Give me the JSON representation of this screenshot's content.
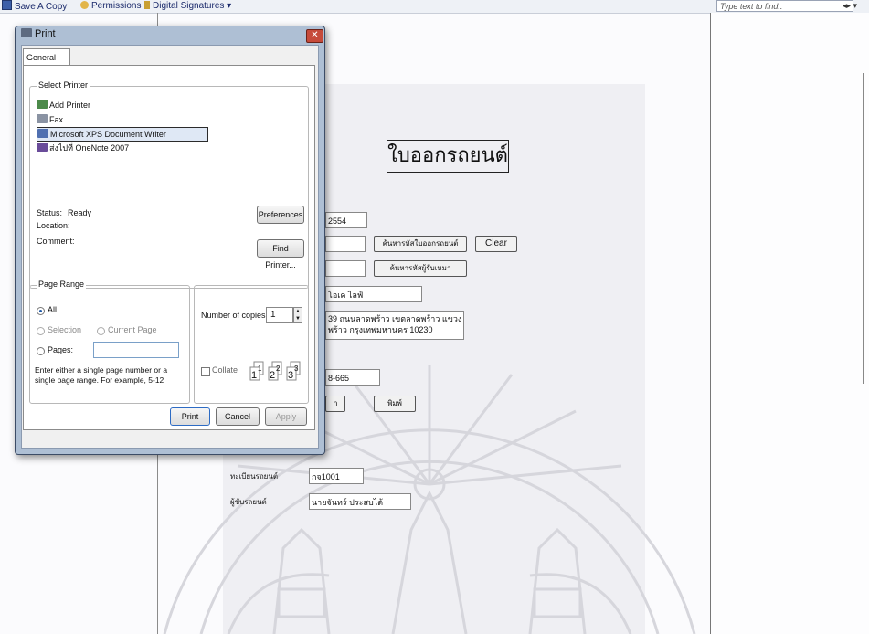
{
  "toolbar": {
    "save_copy": "Save A Copy",
    "permissions": "Permissions",
    "digital_signatures": "Digital Signatures ▾",
    "find_placeholder": "Type text to find..",
    "find_nav": "◂▸ ▾"
  },
  "document": {
    "title": "ใบออกรถยนต์",
    "year_field": "2554",
    "search_receipt_button": "ค้นหารหัสใบออกรถยนต์",
    "clear_button": "Clear",
    "search_owner_button": "ค้นหารหัสผู้รับเหมา",
    "company_field": "โอเค ไลฟ์",
    "address_line1": "39 ถนนลาดพร้าว เขตลาดพร้าว แขวง",
    "address_line2": "พร้าว กรุงเทพมหานคร 10230",
    "phone_field": "8-665",
    "left_button_partial": "n",
    "print_button_thai": "พิมพ์",
    "vehicle_reg_label": "ทะเบียนรถยนต์",
    "vehicle_reg_value": "กจ1001",
    "driver_label": "ผู้ขับรถยนต์",
    "driver_value": "นายจันทร์ ประสบได้"
  },
  "dialog": {
    "title": "Print",
    "close": "✕",
    "tab_general": "General",
    "select_printer_label": "Select Printer",
    "printers": [
      "Add Printer",
      "Fax",
      "Microsoft XPS Document Writer",
      "ส่งไปที่ OneNote 2007"
    ],
    "selected_printer_index": 2,
    "status_label": "Status:",
    "status_value": "Ready",
    "location_label": "Location:",
    "comment_label": "Comment:",
    "preferences_button": "Preferences",
    "find_printer_button": "Find Printer...",
    "page_range_label": "Page Range",
    "range_all": "All",
    "range_selection": "Selection",
    "range_current": "Current Page",
    "range_pages": "Pages:",
    "range_hint": "Enter either a single page number or a single page range.  For example, 5-12",
    "copies_label": "Number of copies:",
    "copies_value": "1",
    "collate_label": "Collate",
    "print_button": "Print",
    "cancel_button": "Cancel",
    "apply_button": "Apply"
  }
}
